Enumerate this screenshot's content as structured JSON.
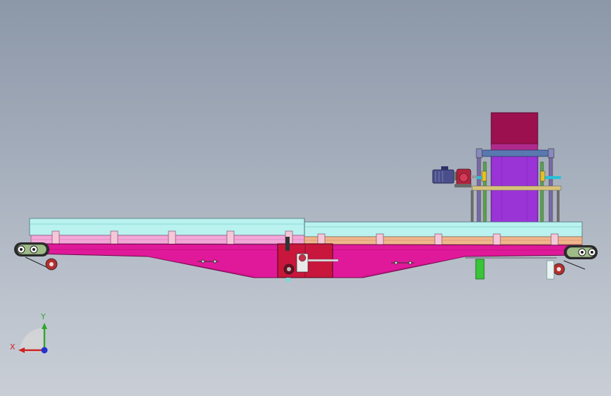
{
  "viewport": {
    "model": "belt-conveyor-assembly",
    "view": "front",
    "background_top": "#8c97a8",
    "background_bottom": "#c9ced6"
  },
  "colors": {
    "frame": "#e0199a",
    "belt_top": "#aef0f0",
    "rail_left": "#f3a6d8",
    "rail_right": "#f0b58c",
    "hopper_top": "#9c1050",
    "hopper_body": "#9b34d6",
    "drive_box": "#c8163d",
    "motor": "#4a4f8c",
    "support_post": "#39c439",
    "end_plate": "#a6c48a"
  },
  "triad": {
    "x_label": "X",
    "y_label": "Y",
    "x_color": "#cc2222",
    "y_color": "#2ea82e",
    "z_color": "#2233cc"
  }
}
